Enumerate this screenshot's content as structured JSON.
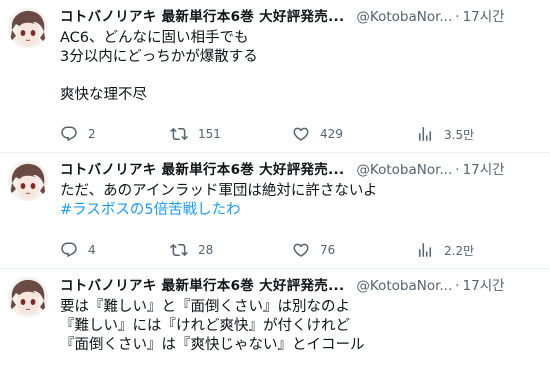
{
  "author": {
    "name": "コトバノリアキ 最新単行本6巻 大好評発売...",
    "handle": "@KotobaNor...",
    "separator": "·"
  },
  "tweets": [
    {
      "time": "17시간",
      "lines": [
        "AC6、どんなに固い相手でも",
        "3分以内にどっちかが爆散する",
        "",
        "爽快な理不尽"
      ],
      "stats": {
        "replies": "2",
        "retweets": "151",
        "likes": "429",
        "views": "3.5만"
      }
    },
    {
      "time": "17시간",
      "lines": [
        "ただ、あのアインラッド軍団は絶対に許さないよ"
      ],
      "hashtag": "#ラスボスの5倍苦戦したわ",
      "stats": {
        "replies": "4",
        "retweets": "28",
        "likes": "76",
        "views": "2.2만"
      }
    },
    {
      "time": "17시간",
      "lines": [
        "要は『難しい』と『面倒くさい』は別なのよ",
        "『難しい』には『けれど爽快』が付くけれど",
        "『面倒くさい』は『爽快じゃない』とイコール"
      ]
    }
  ],
  "icons": {
    "reply": "reply-icon",
    "retweet": "retweet-icon",
    "like": "heart-icon",
    "views": "views-chart-icon"
  }
}
